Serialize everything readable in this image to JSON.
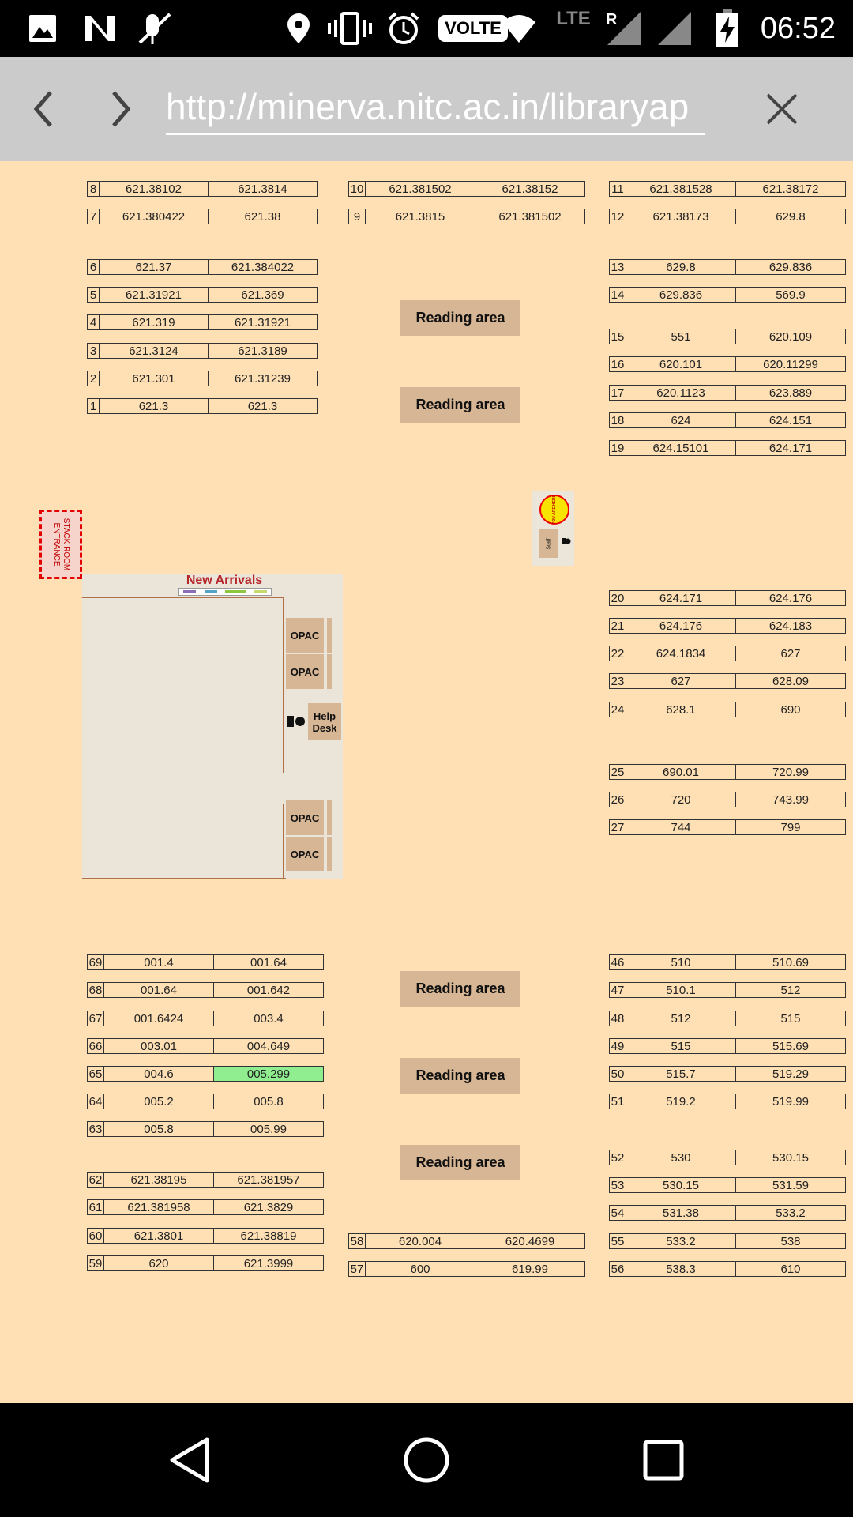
{
  "status_bar": {
    "time": "06:52",
    "volte": "VOLTE",
    "network": "LTE",
    "roaming": "R",
    "icons": [
      "image-icon",
      "n-icon",
      "mute-icon",
      "location-icon",
      "vibrate-icon",
      "alarm-icon",
      "wifi-icon",
      "signal-icon",
      "signal-icon",
      "battery-charging-icon"
    ]
  },
  "browser": {
    "url": "http://minerva.nitc.ac.in/libraryap",
    "back_icon": "chevron-left-icon",
    "forward_icon": "chevron-right-icon",
    "close_icon": "close-icon"
  },
  "map": {
    "reading_area_label": "Reading area",
    "entrance_label": "STACK ROOM ENTRANCE",
    "new_arrivals_label": "New Arrivals",
    "opac_label": "OPAC",
    "help_desk_label": "Help Desk",
    "you_are_here_label": "YOU ARE HERE",
    "staff_label": "Staff",
    "racks": [
      {
        "id": "8",
        "from": "621.38102",
        "to": "621.3814"
      },
      {
        "id": "7",
        "from": "621.380422",
        "to": "621.38"
      },
      {
        "id": "6",
        "from": "621.37",
        "to": "621.384022"
      },
      {
        "id": "5",
        "from": "621.31921",
        "to": "621.369"
      },
      {
        "id": "4",
        "from": "621.319",
        "to": "621.31921"
      },
      {
        "id": "3",
        "from": "621.3124",
        "to": "621.3189"
      },
      {
        "id": "2",
        "from": "621.301",
        "to": "621.31239"
      },
      {
        "id": "1",
        "from": "621.3",
        "to": "621.3"
      },
      {
        "id": "10",
        "from": "621.381502",
        "to": "621.38152"
      },
      {
        "id": "9",
        "from": "621.3815",
        "to": "621.381502"
      },
      {
        "id": "11",
        "from": "621.381528",
        "to": "621.38172"
      },
      {
        "id": "12",
        "from": "621.38173",
        "to": "629.8"
      },
      {
        "id": "13",
        "from": "629.8",
        "to": "629.836"
      },
      {
        "id": "14",
        "from": "629.836",
        "to": "569.9"
      },
      {
        "id": "15",
        "from": "551",
        "to": "620.109"
      },
      {
        "id": "16",
        "from": "620.101",
        "to": "620.11299"
      },
      {
        "id": "17",
        "from": "620.1123",
        "to": "623.889"
      },
      {
        "id": "18",
        "from": "624",
        "to": "624.151"
      },
      {
        "id": "19",
        "from": "624.15101",
        "to": "624.171"
      },
      {
        "id": "20",
        "from": "624.171",
        "to": "624.176"
      },
      {
        "id": "21",
        "from": "624.176",
        "to": "624.183"
      },
      {
        "id": "22",
        "from": "624.1834",
        "to": "627"
      },
      {
        "id": "23",
        "from": "627",
        "to": "628.09"
      },
      {
        "id": "24",
        "from": "628.1",
        "to": "690"
      },
      {
        "id": "25",
        "from": "690.01",
        "to": "720.99"
      },
      {
        "id": "26",
        "from": "720",
        "to": "743.99"
      },
      {
        "id": "27",
        "from": "744",
        "to": "799"
      },
      {
        "id": "69",
        "from": "001.4",
        "to": "001.64"
      },
      {
        "id": "68",
        "from": "001.64",
        "to": "001.642"
      },
      {
        "id": "67",
        "from": "001.6424",
        "to": "003.4"
      },
      {
        "id": "66",
        "from": "003.01",
        "to": "004.649"
      },
      {
        "id": "65",
        "from": "004.6",
        "to": "005.299",
        "highlight": true
      },
      {
        "id": "64",
        "from": "005.2",
        "to": "005.8"
      },
      {
        "id": "63",
        "from": "005.8",
        "to": "005.99"
      },
      {
        "id": "62",
        "from": "621.38195",
        "to": "621.381957"
      },
      {
        "id": "61",
        "from": "621.381958",
        "to": "621.3829"
      },
      {
        "id": "60",
        "from": "621.3801",
        "to": "621.38819"
      },
      {
        "id": "59",
        "from": "620",
        "to": "621.3999"
      },
      {
        "id": "58",
        "from": "620.004",
        "to": "620.4699"
      },
      {
        "id": "57",
        "from": "600",
        "to": "619.99"
      },
      {
        "id": "46",
        "from": "510",
        "to": "510.69"
      },
      {
        "id": "47",
        "from": "510.1",
        "to": "512"
      },
      {
        "id": "48",
        "from": "512",
        "to": "515"
      },
      {
        "id": "49",
        "from": "515",
        "to": "515.69"
      },
      {
        "id": "50",
        "from": "515.7",
        "to": "519.29"
      },
      {
        "id": "51",
        "from": "519.2",
        "to": "519.99"
      },
      {
        "id": "52",
        "from": "530",
        "to": "530.15"
      },
      {
        "id": "53",
        "from": "530.15",
        "to": "531.59"
      },
      {
        "id": "54",
        "from": "531.38",
        "to": "533.2"
      },
      {
        "id": "55",
        "from": "533.2",
        "to": "538"
      },
      {
        "id": "56",
        "from": "538.3",
        "to": "610"
      }
    ]
  },
  "nav_bar": {
    "icons": [
      "back-triangle-icon",
      "home-circle-icon",
      "recents-square-icon"
    ]
  }
}
